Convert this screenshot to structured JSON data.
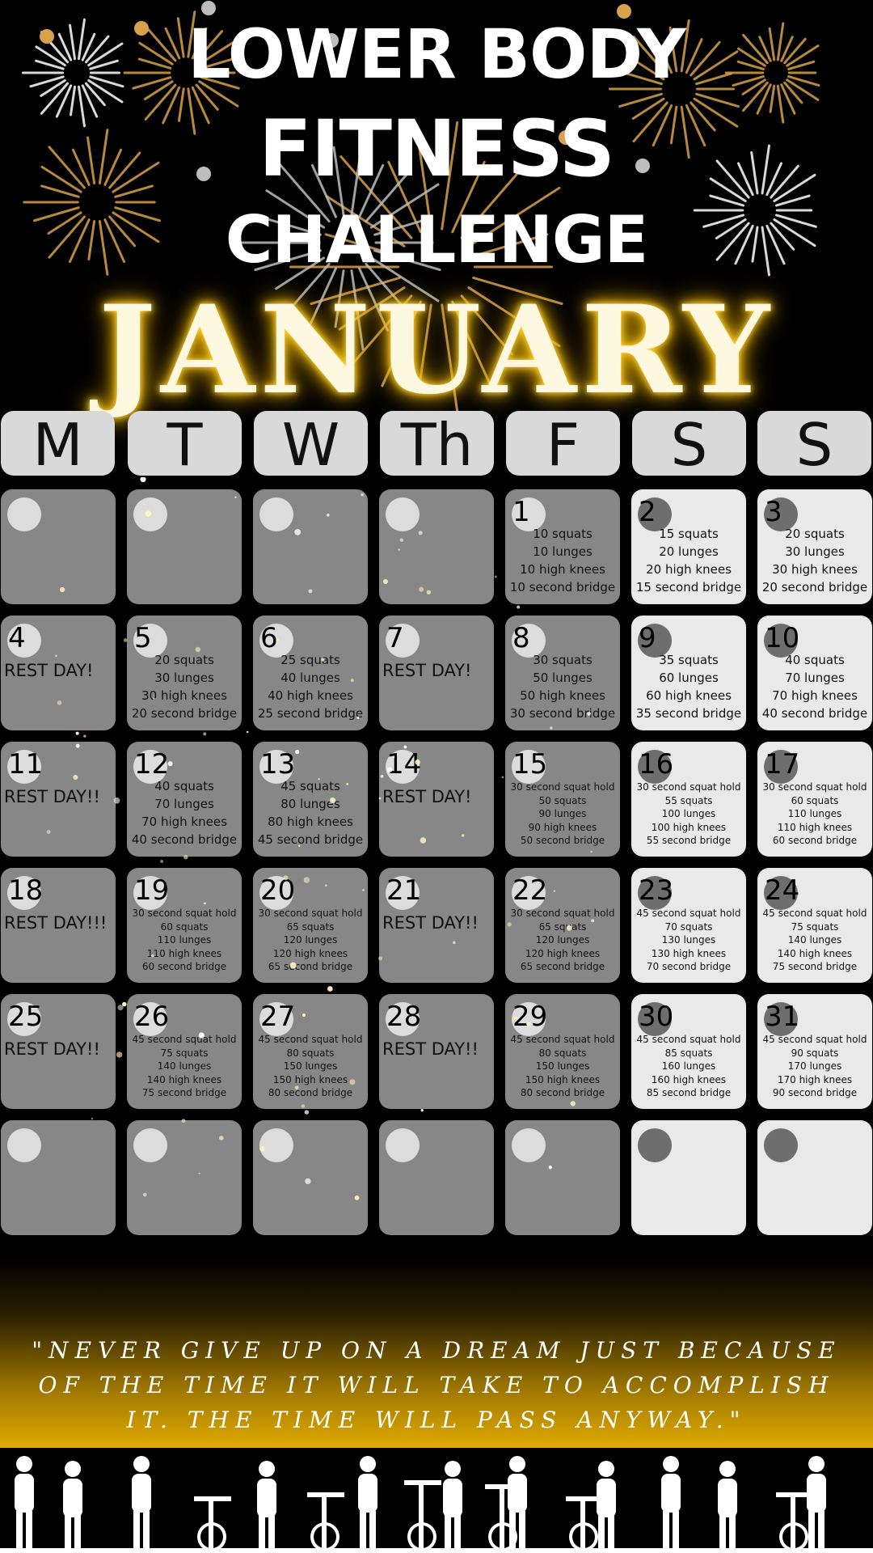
{
  "header": {
    "line1": "LOWER BODY",
    "line2": "FITNESS",
    "line3": "CHALLENGE",
    "month": "JANUARY"
  },
  "weekdays": [
    "M",
    "T",
    "W",
    "Th",
    "F",
    "S",
    "S"
  ],
  "days": {
    "d1": {
      "num": "1",
      "lines": [
        "10 squats",
        "10 lunges",
        "10 high knees",
        "10 second bridge"
      ]
    },
    "d2": {
      "num": "2",
      "lines": [
        "15 squats",
        "20 lunges",
        "20 high knees",
        "15 second bridge"
      ]
    },
    "d3": {
      "num": "3",
      "lines": [
        "20 squats",
        "30 lunges",
        "30 high knees",
        "20 second bridge"
      ]
    },
    "d4": {
      "num": "4",
      "rest": "REST DAY!"
    },
    "d5": {
      "num": "5",
      "lines": [
        "20 squats",
        "30 lunges",
        "30 high knees",
        "20 second bridge"
      ]
    },
    "d6": {
      "num": "6",
      "lines": [
        "25 squats",
        "40 lunges",
        "40 high knees",
        "25 second bridge"
      ]
    },
    "d7": {
      "num": "7",
      "rest": "REST DAY!"
    },
    "d8": {
      "num": "8",
      "lines": [
        "30 squats",
        "50 lunges",
        "50 high knees",
        "30 second bridge"
      ]
    },
    "d9": {
      "num": "9",
      "lines": [
        "35 squats",
        "60 lunges",
        "60 high knees",
        "35 second bridge"
      ]
    },
    "d10": {
      "num": "10",
      "lines": [
        "40 squats",
        "70 lunges",
        "70 high knees",
        "40 second bridge"
      ]
    },
    "d11": {
      "num": "11",
      "rest": "REST DAY!!"
    },
    "d12": {
      "num": "12",
      "lines": [
        "40 squats",
        "70 lunges",
        "70 high knees",
        "40 second bridge"
      ]
    },
    "d13": {
      "num": "13",
      "lines": [
        "45 squats",
        "80 lunges",
        "80 high knees",
        "45 second bridge"
      ]
    },
    "d14": {
      "num": "14",
      "rest": "REST DAY!"
    },
    "d15": {
      "num": "15",
      "lines": [
        "30 second squat hold",
        "50 squats",
        "90 lunges",
        "90 high knees",
        "50 second bridge"
      ]
    },
    "d16": {
      "num": "16",
      "lines": [
        "30 second squat hold",
        "55 squats",
        "100 lunges",
        "100 high knees",
        "55 second bridge"
      ]
    },
    "d17": {
      "num": "17",
      "lines": [
        "30 second squat hold",
        "60 squats",
        "110 lunges",
        "110 high knees",
        "60 second bridge"
      ]
    },
    "d18": {
      "num": "18",
      "rest": "REST DAY!!!"
    },
    "d19": {
      "num": "19",
      "lines": [
        "30 second squat hold",
        "60 squats",
        "110 lunges",
        "110 high knees",
        "60 second bridge"
      ]
    },
    "d20": {
      "num": "20",
      "lines": [
        "30 second squat hold",
        "65 squats",
        "120 lunges",
        "120 high knees",
        "65 second bridge"
      ]
    },
    "d21": {
      "num": "21",
      "rest": "REST DAY!!"
    },
    "d22": {
      "num": "22",
      "lines": [
        "30 second squat hold",
        "65 squats",
        "120 lunges",
        "120 high knees",
        "65 second bridge"
      ]
    },
    "d23": {
      "num": "23",
      "lines": [
        "45 second squat hold",
        "70 squats",
        "130 lunges",
        "130 high knees",
        "70 second bridge"
      ]
    },
    "d24": {
      "num": "24",
      "lines": [
        "45 second squat hold",
        "75 squats",
        "140 lunges",
        "140 high knees",
        "75 second bridge"
      ]
    },
    "d25": {
      "num": "25",
      "rest": "REST DAY!!"
    },
    "d26": {
      "num": "26",
      "lines": [
        "45 second squat hold",
        "75 squats",
        "140 lunges",
        "140 high knees",
        "75 second bridge"
      ]
    },
    "d27": {
      "num": "27",
      "lines": [
        "45 second squat hold",
        "80 squats",
        "150 lunges",
        "150 high knees",
        "80 second bridge"
      ]
    },
    "d28": {
      "num": "28",
      "rest": "REST DAY!!"
    },
    "d29": {
      "num": "29",
      "lines": [
        "45 second squat hold",
        "80 squats",
        "150 lunges",
        "150 high knees",
        "80 second bridge"
      ]
    },
    "d30": {
      "num": "30",
      "lines": [
        "45 second squat hold",
        "85 squats",
        "160 lunges",
        "160 high knees",
        "85 second bridge"
      ]
    },
    "d31": {
      "num": "31",
      "lines": [
        "45 second squat hold",
        "90 squats",
        "170 lunges",
        "170 high knees",
        "90 second bridge"
      ]
    }
  },
  "quote": "\"NEVER GIVE UP ON A DREAM JUST BECAUSE OF THE TIME IT WILL TAKE TO ACCOMPLISH IT. THE TIME WILL PASS ANYWAY.\"",
  "colors": {
    "background": "#000000",
    "weekday_cell": "#878787",
    "weekend_cell": "#e9e9e9",
    "header_pill": "#d9d9d9",
    "gold": "#e0aa00",
    "glow": "#ffc400"
  }
}
